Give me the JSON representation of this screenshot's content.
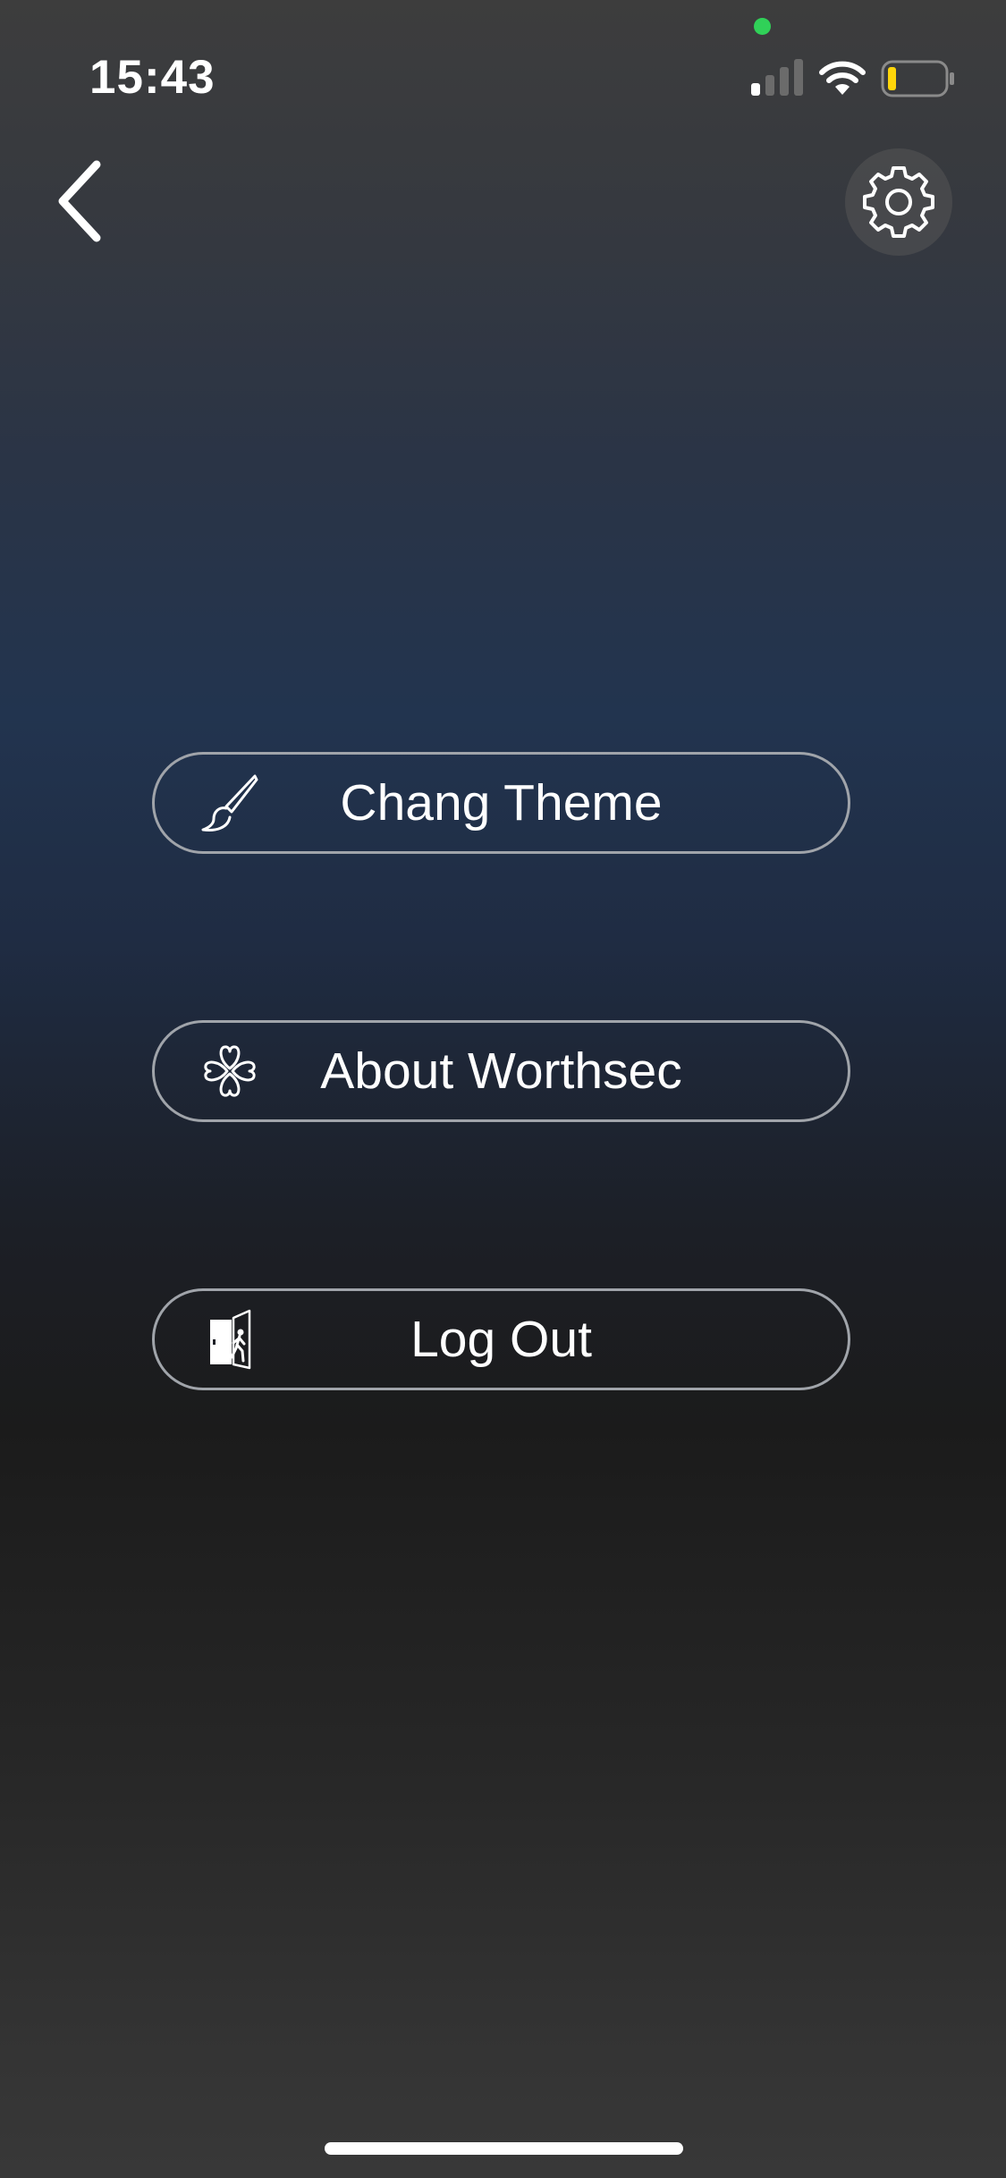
{
  "status_bar": {
    "time": "15:43",
    "signal_icon": "cellular-signal-icon",
    "wifi_icon": "wifi-icon",
    "battery_icon": "battery-low-icon",
    "privacy_indicator_color": "#30d158",
    "battery_level_color": "#ffd60a"
  },
  "nav": {
    "back_icon": "chevron-left-icon",
    "settings_icon": "gear-icon"
  },
  "menu": {
    "items": [
      {
        "label": "Chang Theme",
        "icon": "paintbrush-icon"
      },
      {
        "label": "About Worthsec",
        "icon": "clover-icon"
      },
      {
        "label": "Log Out",
        "icon": "exit-door-icon"
      }
    ]
  },
  "colors": {
    "button_border": "#a0a4aa",
    "text": "#ffffff"
  }
}
